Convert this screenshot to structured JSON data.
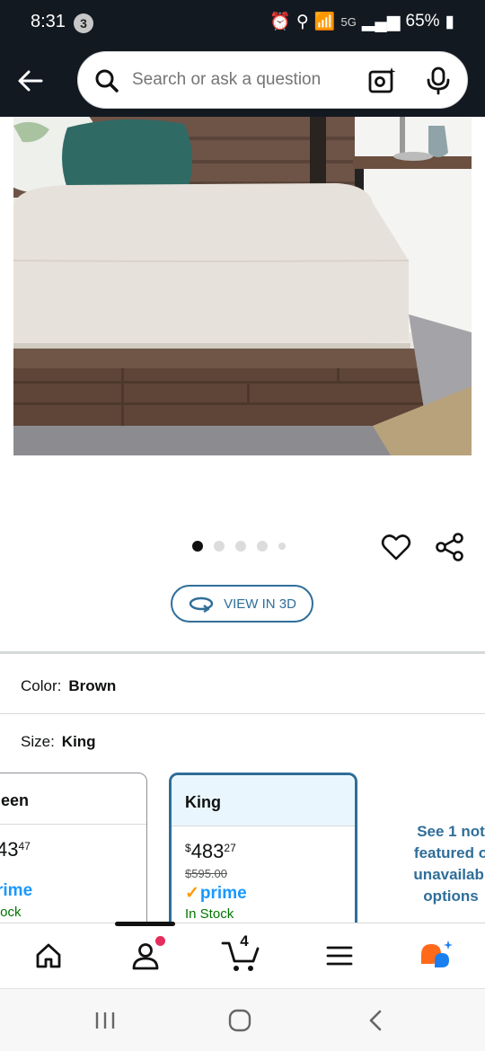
{
  "status_bar": {
    "time": "8:31",
    "notification_count": "3",
    "network": "5G",
    "battery": "65%"
  },
  "header": {
    "search_placeholder": "Search or ask a question"
  },
  "product": {
    "image_alt": "Platform bed with wood frame and white mattress",
    "carousel": {
      "total": 5,
      "active": 0
    },
    "view_3d_label": "VIEW IN 3D"
  },
  "variations": {
    "color_label": "Color:",
    "color_value": "Brown",
    "size_label": "Size:",
    "size_value": "King"
  },
  "size_options": [
    {
      "name": "een",
      "price_whole": "43",
      "price_fraction": "47",
      "prime": "rime",
      "stock": "tock"
    },
    {
      "name": "King",
      "price_symbol": "$",
      "price_whole": "483",
      "price_fraction": "27",
      "list_price": "$595.00",
      "prime": "prime",
      "stock": "In Stock",
      "selected": true
    }
  ],
  "see_more": {
    "line1": "See 1 not",
    "line2": "featured o",
    "line3": "unavailabl",
    "line4": "options"
  },
  "bottom_nav": {
    "items": [
      "home-icon",
      "account-icon",
      "cart-icon",
      "menu-icon",
      "rufus-icon"
    ],
    "cart_count": "4",
    "active_index": 1
  },
  "colors": {
    "header_bg": "#131921",
    "link_blue": "#2f6e99",
    "prime_blue": "#1a98ff",
    "stock_green": "#007600",
    "prime_check": "#ff9900"
  }
}
